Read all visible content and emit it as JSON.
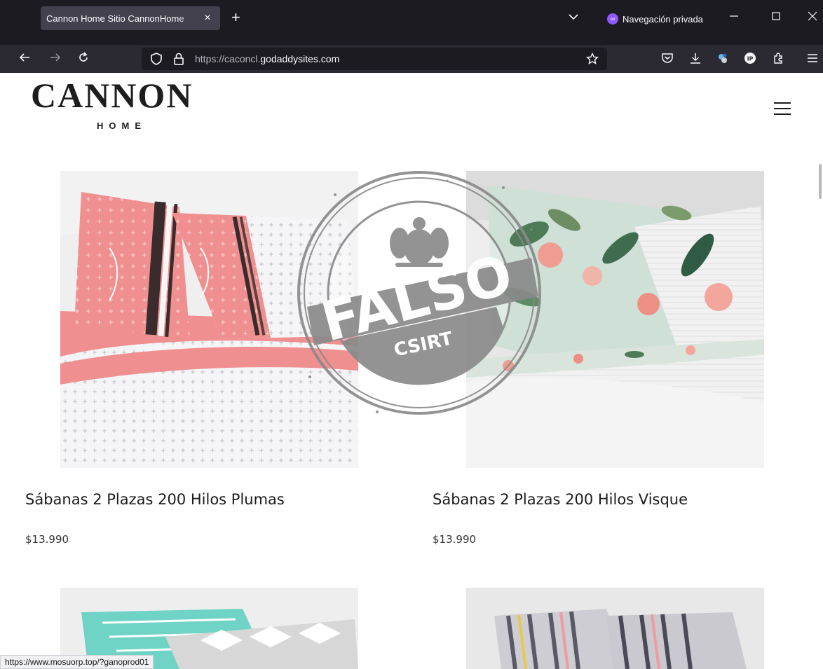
{
  "browser": {
    "tab_title": "Cannon Home Sitio CannonHome",
    "tab_close": "×",
    "new_tab": "+",
    "private_label": "Navegación privada",
    "url_scheme": "https://",
    "url_subdomain": "caconcl.",
    "url_domain": "godaddysites.com",
    "status_url": "https://www.mosuorp.top/?ganoprod01"
  },
  "site": {
    "logo_main": "CANNON",
    "logo_sub": "HOME"
  },
  "stamp": {
    "word": "FALSO",
    "org": "CSIRT"
  },
  "products": [
    {
      "name": "Sábanas 2 Plazas 200 Hilos Plumas",
      "price": "$13.990"
    },
    {
      "name": "Sábanas 2 Plazas 200 Hilos Visque",
      "price": "$13.990"
    }
  ],
  "colors": {
    "chrome_dark": "#1c1b22",
    "toolbar": "#2b2a33",
    "private_purple": "#9059ff",
    "stamp_gray": "#8a8a8a"
  }
}
